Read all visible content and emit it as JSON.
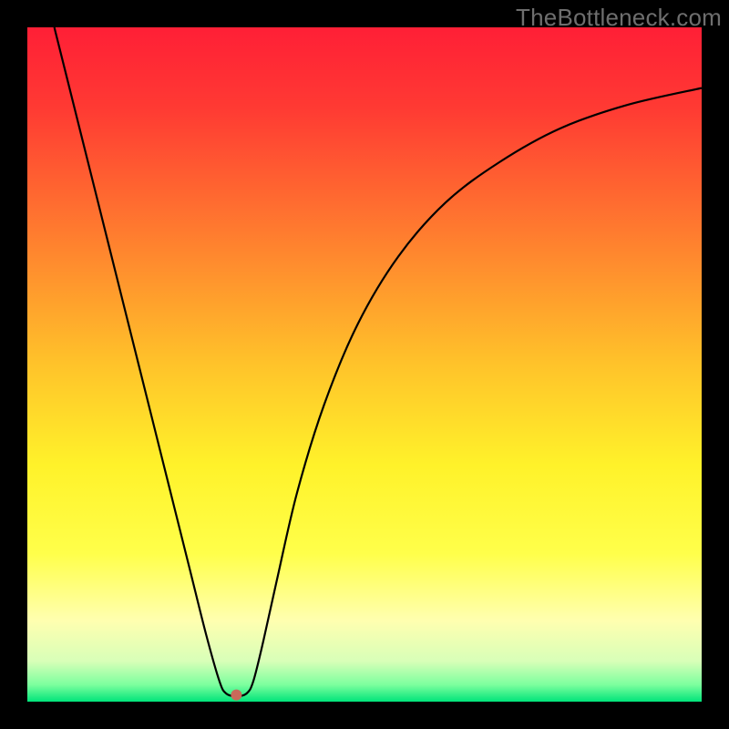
{
  "watermark": "TheBottleneck.com",
  "chart_data": {
    "type": "line",
    "title": "",
    "xlabel": "",
    "ylabel": "",
    "xlim": [
      0,
      100
    ],
    "ylim": [
      0,
      100
    ],
    "background_gradient": {
      "stops": [
        {
          "offset": 0.0,
          "color": "#ff1f36"
        },
        {
          "offset": 0.12,
          "color": "#ff3a33"
        },
        {
          "offset": 0.3,
          "color": "#ff7a2f"
        },
        {
          "offset": 0.5,
          "color": "#ffc32a"
        },
        {
          "offset": 0.65,
          "color": "#fff22a"
        },
        {
          "offset": 0.78,
          "color": "#ffff4a"
        },
        {
          "offset": 0.88,
          "color": "#ffffb0"
        },
        {
          "offset": 0.94,
          "color": "#d8ffb8"
        },
        {
          "offset": 0.975,
          "color": "#7cff9e"
        },
        {
          "offset": 1.0,
          "color": "#00e47a"
        }
      ]
    },
    "series": [
      {
        "name": "bottleneck-curve",
        "color": "#000000",
        "stroke_width": 2.2,
        "points": [
          {
            "x": 4.0,
            "y": 100.0
          },
          {
            "x": 6.0,
            "y": 92.0
          },
          {
            "x": 9.0,
            "y": 80.0
          },
          {
            "x": 12.0,
            "y": 68.0
          },
          {
            "x": 15.0,
            "y": 56.0
          },
          {
            "x": 18.0,
            "y": 44.0
          },
          {
            "x": 21.0,
            "y": 32.0
          },
          {
            "x": 24.0,
            "y": 20.0
          },
          {
            "x": 26.5,
            "y": 10.0
          },
          {
            "x": 28.5,
            "y": 3.0
          },
          {
            "x": 29.5,
            "y": 1.2
          },
          {
            "x": 31.0,
            "y": 0.8
          },
          {
            "x": 32.5,
            "y": 1.2
          },
          {
            "x": 33.5,
            "y": 3.0
          },
          {
            "x": 35.0,
            "y": 9.0
          },
          {
            "x": 37.0,
            "y": 18.0
          },
          {
            "x": 40.0,
            "y": 31.0
          },
          {
            "x": 44.0,
            "y": 44.0
          },
          {
            "x": 49.0,
            "y": 56.0
          },
          {
            "x": 55.0,
            "y": 66.0
          },
          {
            "x": 62.0,
            "y": 74.0
          },
          {
            "x": 70.0,
            "y": 80.0
          },
          {
            "x": 79.0,
            "y": 85.0
          },
          {
            "x": 89.0,
            "y": 88.5
          },
          {
            "x": 100.0,
            "y": 91.0
          }
        ]
      }
    ],
    "markers": [
      {
        "name": "min-marker",
        "x": 31.0,
        "y": 1.0,
        "r": 6,
        "fill": "#c86a5a"
      }
    ]
  }
}
